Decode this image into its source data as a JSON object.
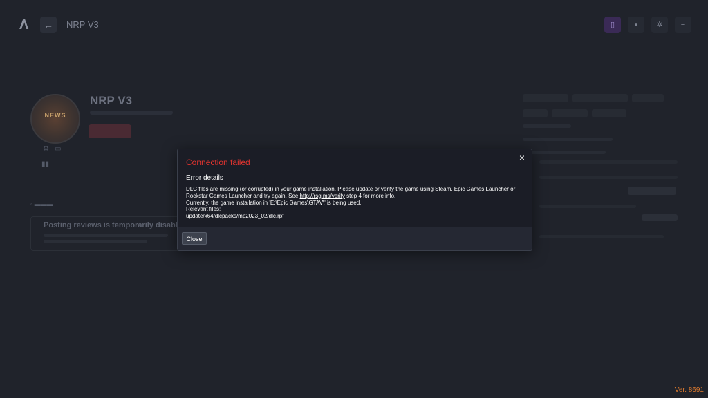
{
  "app": {
    "title": "NRP V3",
    "logo_glyph": "Λ",
    "back_icon": "arrow-left-icon",
    "top_icons": [
      "profile-icon",
      "tools-icon",
      "gear-icon",
      "menu-icon"
    ]
  },
  "server": {
    "name": "NRP V3",
    "logo_text": "NEWS"
  },
  "reviews": {
    "title": "Posting reviews is temporarily disabled"
  },
  "modal": {
    "title": "Connection failed",
    "subtitle": "Error details",
    "line1": "DLC files are missing (or corrupted) in your game installation. Please update or verify the game using Steam, Epic Games Launcher or",
    "line2_pre": "Rockstar Games Launcher and try again. See ",
    "link": "http://rsg.ms/verify",
    "line2_post": " step 4 for more info.",
    "line3": "Currently, the game installation in 'E:\\Epic Games\\GTAV\\' is being used.",
    "line4": "Relevant files:",
    "line5": "update/x64/dlcpacks/mp2023_02/dlc.rpf",
    "close_label": "Close",
    "close_x": "×"
  },
  "version": "Ver. 8691",
  "colors": {
    "background": "#20232b",
    "modal_bg": "#1b1d26",
    "error_red": "#e3342f",
    "version_orange": "#e07b2e"
  }
}
